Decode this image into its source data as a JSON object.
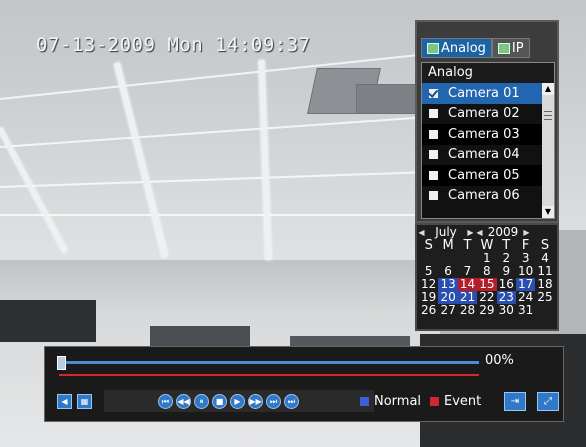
{
  "osd": {
    "timestamp": "07-13-2009 Mon 14:09:37"
  },
  "camera_panel": {
    "tabs": [
      {
        "label": "Analog",
        "active": true,
        "icon": "analog-icon"
      },
      {
        "label": "IP",
        "active": false,
        "icon": "ip-icon"
      }
    ],
    "list_header": "Analog",
    "cameras": [
      {
        "label": "Camera 01",
        "checked": true,
        "selected": true
      },
      {
        "label": "Camera 02",
        "checked": false,
        "selected": false
      },
      {
        "label": "Camera 03",
        "checked": false,
        "selected": false
      },
      {
        "label": "Camera 04",
        "checked": false,
        "selected": false
      },
      {
        "label": "Camera 05",
        "checked": false,
        "selected": false
      },
      {
        "label": "Camera 06",
        "checked": false,
        "selected": false
      }
    ]
  },
  "calendar": {
    "month": "July",
    "year": "2009",
    "weekdays": [
      "S",
      "M",
      "T",
      "W",
      "T",
      "F",
      "S"
    ],
    "weeks": [
      [
        "",
        "",
        "",
        "1",
        "2",
        "3",
        "4"
      ],
      [
        "5",
        "6",
        "7",
        "8",
        "9",
        "10",
        "11"
      ],
      [
        "12",
        "13",
        "14",
        "15",
        "16",
        "17",
        "18"
      ],
      [
        "19",
        "20",
        "21",
        "22",
        "23",
        "24",
        "25"
      ],
      [
        "26",
        "27",
        "28",
        "29",
        "30",
        "31",
        ""
      ]
    ],
    "normal_days": [
      "13",
      "17",
      "20",
      "21",
      "23"
    ],
    "event_days": [
      "14",
      "15"
    ],
    "colors": {
      "normal": "#2b4fae",
      "event": "#b51d2a"
    }
  },
  "playback": {
    "progress_percent": 0,
    "progress_label": "00%",
    "legend": [
      {
        "label": "Normal",
        "color": "#3a5fd6"
      },
      {
        "label": "Event",
        "color": "#d4262f"
      }
    ],
    "buttons": [
      {
        "name": "audio-icon",
        "glyph": "◀"
      },
      {
        "name": "clip-icon",
        "glyph": "▦"
      },
      {
        "name": "skip-start-icon",
        "glyph": "⏮"
      },
      {
        "name": "rewind-icon",
        "glyph": "◀◀"
      },
      {
        "name": "pause-icon",
        "glyph": "⏸"
      },
      {
        "name": "stop-icon",
        "glyph": "■"
      },
      {
        "name": "play-icon",
        "glyph": "▶"
      },
      {
        "name": "fast-forward-icon",
        "glyph": "▶▶"
      },
      {
        "name": "skip-forward-icon",
        "glyph": "⏭"
      },
      {
        "name": "skip-end-icon",
        "glyph": "⏭"
      },
      {
        "name": "exit-icon",
        "glyph": "⇥"
      },
      {
        "name": "fullscreen-icon",
        "glyph": "⤢"
      }
    ]
  }
}
